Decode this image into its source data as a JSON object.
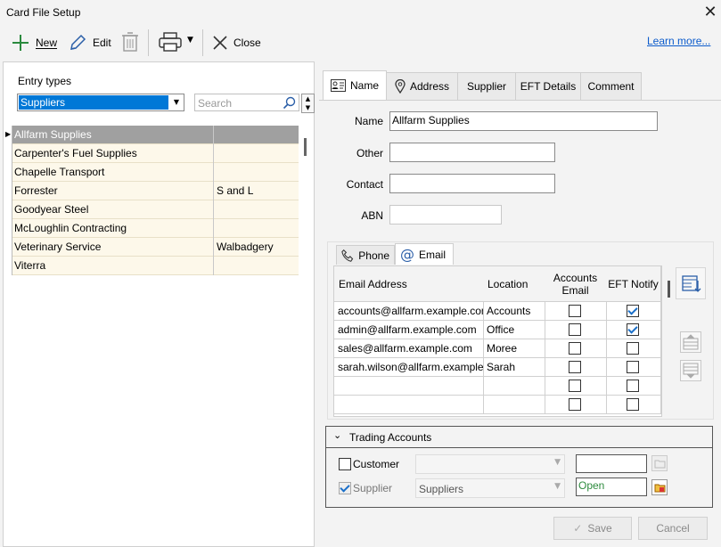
{
  "window": {
    "title": "Card File Setup"
  },
  "toolbar": {
    "new_label": "New",
    "edit_label": "Edit",
    "close_label": "Close",
    "learn_more": "Learn more..."
  },
  "entry": {
    "label": "Entry types",
    "selected": "Suppliers",
    "search_placeholder": "Search"
  },
  "cards": [
    {
      "name": "Allfarm Supplies",
      "other": "",
      "selected": true
    },
    {
      "name": "Carpenter's Fuel Supplies",
      "other": ""
    },
    {
      "name": "Chapelle Transport",
      "other": ""
    },
    {
      "name": "Forrester",
      "other": "S and L"
    },
    {
      "name": "Goodyear Steel",
      "other": ""
    },
    {
      "name": "McLoughlin Contracting",
      "other": ""
    },
    {
      "name": "Veterinary Service",
      "other": "Walbadgery"
    },
    {
      "name": "Viterra",
      "other": ""
    }
  ],
  "tabs": [
    {
      "label": "Name",
      "icon": "contact-card-icon"
    },
    {
      "label": "Address",
      "icon": "map-pin-icon"
    },
    {
      "label": "Supplier"
    },
    {
      "label": "EFT Details"
    },
    {
      "label": "Comment"
    }
  ],
  "form": {
    "name_label": "Name",
    "name_value": "Allfarm Supplies",
    "other_label": "Other",
    "other_value": "",
    "contact_label": "Contact",
    "contact_value": "",
    "abn_label": "ABN",
    "abn_value": ""
  },
  "subtabs": {
    "phone": "Phone",
    "email": "Email"
  },
  "email_grid": {
    "headers": {
      "address": "Email Address",
      "location": "Location",
      "accounts": "Accounts Email",
      "eft": "EFT Notify"
    },
    "rows": [
      {
        "address": "accounts@allfarm.example.com",
        "location": "Accounts",
        "accounts": false,
        "eft": true
      },
      {
        "address": "admin@allfarm.example.com",
        "location": "Office",
        "accounts": false,
        "eft": true
      },
      {
        "address": "sales@allfarm.example.com",
        "location": "Moree",
        "accounts": false,
        "eft": false
      },
      {
        "address": "sarah.wilson@allfarm.example.com",
        "location": "Sarah",
        "accounts": false,
        "eft": false
      },
      {
        "address": "",
        "location": "",
        "accounts": false,
        "eft": false
      },
      {
        "address": "",
        "location": "",
        "accounts": false,
        "eft": false
      }
    ]
  },
  "trading": {
    "title": "Trading Accounts",
    "customer_label": "Customer",
    "customer_checked": false,
    "customer_combo": "",
    "customer_field": "",
    "supplier_label": "Supplier",
    "supplier_checked": true,
    "supplier_combo": "Suppliers",
    "supplier_field": "Open"
  },
  "buttons": {
    "save": "Save",
    "cancel": "Cancel"
  },
  "colors": {
    "accent": "#0078d7",
    "row_bg": "#fdf8ea",
    "link": "#0b5bcc",
    "open_border": "#2e8b3e"
  }
}
